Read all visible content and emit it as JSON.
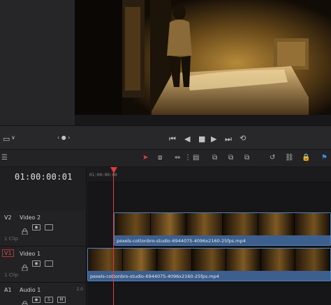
{
  "viewer": {
    "transport_icons": [
      "go-to-start-icon",
      "step-back-icon",
      "stop-icon",
      "play-icon",
      "step-forward-icon",
      "loop-icon"
    ]
  },
  "timeline": {
    "timecode": "01:00:00:01",
    "ruler_start": "01:00:00:00",
    "playhead_color": "#e23b3b"
  },
  "tracks": [
    {
      "id": "V2",
      "name": "Video 2",
      "clips_label": "1 Clip"
    },
    {
      "id": "V1",
      "name": "Video 1",
      "clips_label": "1 Clip"
    },
    {
      "id": "A1",
      "name": "Audio 1",
      "channels": "2.0",
      "solo": "S",
      "mute": "M"
    }
  ],
  "clips": {
    "v2_name": "pexels-cottonbro-studio-6944075-4096x2160-25fps.mp4",
    "v1_name": "pexels-cottonbro-studio-6944075-4096x2160-25fps.mp4"
  },
  "colors": {
    "clip_bar": "#3d5f8d",
    "clip_border": "#4f7fb8",
    "selected_tool": "#e04848",
    "flag": "#3a8ee6"
  }
}
